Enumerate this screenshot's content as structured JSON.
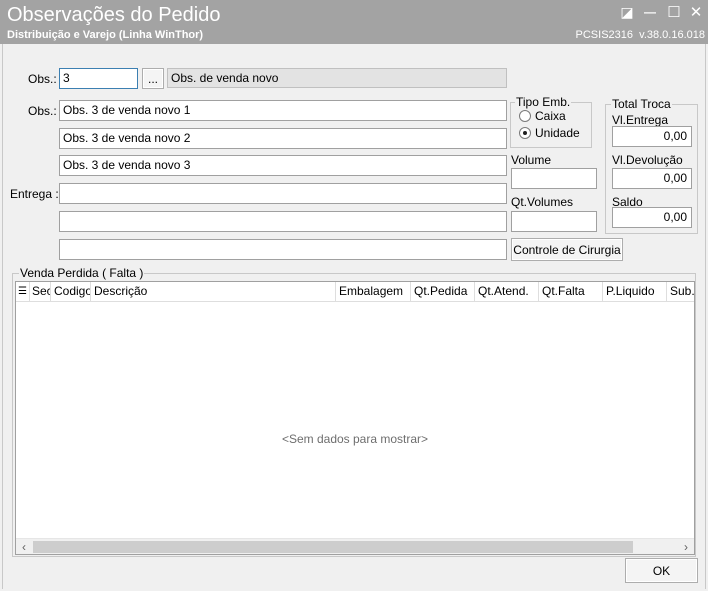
{
  "window": {
    "title": "Observações do Pedido",
    "subtitle": "Distribuição e Varejo (Linha WinThor)",
    "program": "PCSIS2316",
    "version": "v.38.0.16.018",
    "controls": [
      "restore-icon",
      "minimize-icon",
      "maximize-icon",
      "close-icon"
    ],
    "restore_glyph": "◪",
    "minimize_glyph": "—",
    "maximize_glyph": "☐",
    "close_glyph": "✕"
  },
  "obs_code": {
    "label": "Obs.:",
    "value": "3",
    "lookup_button": "...",
    "description": "Obs. de venda novo"
  },
  "obs_lines": {
    "label": "Obs.:",
    "values": [
      "Obs. 3 de venda novo 1",
      "Obs. 3 de venda novo 2",
      "Obs. 3 de venda novo 3"
    ]
  },
  "entrega": {
    "label": "Entrega :",
    "values": [
      "",
      "",
      ""
    ]
  },
  "tipo_emb": {
    "title": "Tipo Emb.",
    "options": [
      "Caixa",
      "Unidade"
    ],
    "selected": "Unidade"
  },
  "volume": {
    "label": "Volume",
    "value": ""
  },
  "qt_volumes": {
    "label": "Qt.Volumes",
    "value": ""
  },
  "controle_cirurgia_button": "Controle de Cirurgia",
  "total_troca": {
    "title": "Total Troca",
    "vl_entrega_label": "Vl.Entrega",
    "vl_entrega": "0,00",
    "vl_devolucao_label": "Vl.Devolução",
    "vl_devolucao": "0,00",
    "saldo_label": "Saldo",
    "saldo": "0,00"
  },
  "venda_perdida": {
    "title": "Venda Perdida ( Falta )",
    "selector_glyph": "☰",
    "columns": [
      "Sec",
      "Codigo",
      "Descrição",
      "Embalagem",
      "Qt.Pedida",
      "Qt.Atend.",
      "Qt.Falta",
      "P.Liquido",
      "Sub.T"
    ],
    "empty_text": "<Sem dados para mostrar>",
    "scroll_left": "‹",
    "scroll_right": "›"
  },
  "ok_button": "OK"
}
